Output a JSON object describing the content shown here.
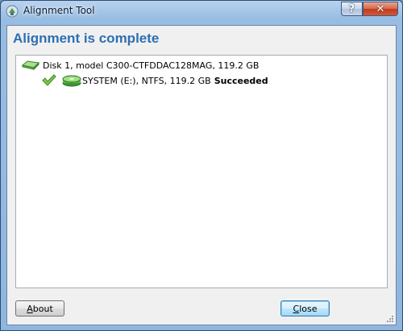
{
  "window": {
    "title": "Alignment Tool",
    "help_button_glyph": "?",
    "close_button_glyph": "✕"
  },
  "heading": "Alignment is complete",
  "results": {
    "disk": {
      "icon": "disk-drive-icon",
      "label": "Disk 1, model C300-CTFDDAC128MAG, 119.2 GB"
    },
    "partition": {
      "status_icon": "checkmark-icon",
      "icon": "partition-icon",
      "label": "SYSTEM (E:), NTFS, 119.2 GB",
      "status": "Succeeded"
    }
  },
  "buttons": {
    "about_accel": "A",
    "about_rest": "bout",
    "close_accel": "C",
    "close_rest": "lose"
  },
  "colors": {
    "heading": "#2d6fb3",
    "check": "#5fae2e",
    "disk_green": "#58b84a"
  }
}
